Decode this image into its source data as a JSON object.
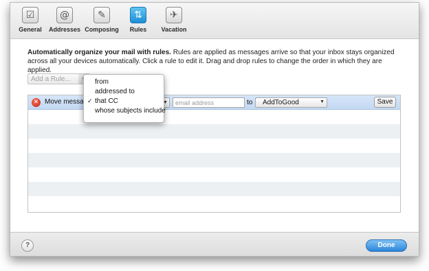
{
  "toolbar": {
    "items": [
      {
        "label": "General",
        "icon": "checkbox-icon",
        "glyph": "☑"
      },
      {
        "label": "Addresses",
        "icon": "at-sign-icon",
        "glyph": "@"
      },
      {
        "label": "Composing",
        "icon": "compose-icon",
        "glyph": "✎"
      },
      {
        "label": "Rules",
        "icon": "rules-fork-icon",
        "glyph": "⇅",
        "active": true
      },
      {
        "label": "Vacation",
        "icon": "airplane-icon",
        "glyph": "✈"
      }
    ]
  },
  "intro": {
    "bold": "Automatically organize your mail with rules.",
    "text": " Rules are applied as messages arrive so that your inbox stays organized across all your devices automatically. Click a rule to edit it. Drag and drop rules to change the order in which they are applied."
  },
  "add_rule": {
    "placeholder": "Add a Rule..."
  },
  "rule": {
    "prefix": "Move message",
    "email_placeholder": "email address",
    "to_label": "to",
    "folder": "AddToGood",
    "save_label": "Save"
  },
  "condition_menu": {
    "items": [
      {
        "label": "from",
        "checked": false
      },
      {
        "label": "addressed to",
        "checked": false
      },
      {
        "label": "that CC",
        "checked": true
      },
      {
        "label": "whose subjects include",
        "checked": false
      }
    ]
  },
  "footer": {
    "help_label": "?",
    "done_label": "Done"
  },
  "colors": {
    "accent": "#2a86db",
    "selected_row": "#c9dcf4",
    "remove": "#d83a22"
  }
}
